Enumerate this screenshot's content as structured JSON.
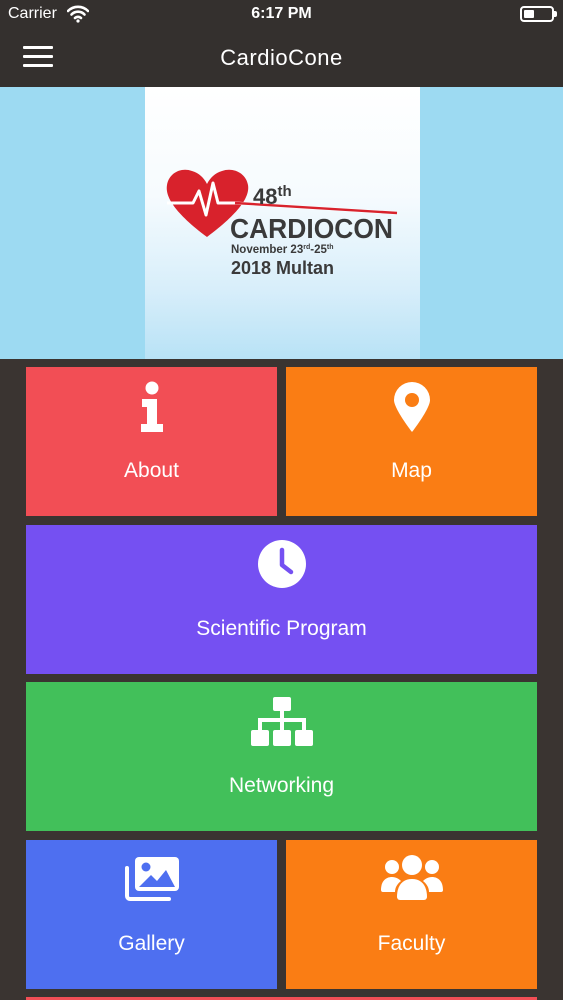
{
  "status_bar": {
    "carrier": "Carrier",
    "time": "6:17 PM"
  },
  "nav": {
    "title": "CardioCone"
  },
  "banner": {
    "edition": "48",
    "edition_suffix": "th",
    "name": "CARDIOCON",
    "dates_prefix": "November 23",
    "dates_sup1": "rd",
    "dates_mid": "-25",
    "dates_sup2": "th",
    "year_city": "2018 Multan",
    "colors": {
      "heart": "#d8222c",
      "text": "#3a3a3a"
    }
  },
  "tiles": {
    "about": {
      "label": "About",
      "icon": "info-icon",
      "color": "#f24e55"
    },
    "map": {
      "label": "Map",
      "icon": "map-marker-icon",
      "color": "#fa7d14"
    },
    "scientific_program": {
      "label": "Scientific Program",
      "icon": "clock-icon",
      "color": "#7550f2"
    },
    "networking": {
      "label": "Networking",
      "icon": "sitemap-icon",
      "color": "#42c05a"
    },
    "gallery": {
      "label": "Gallery",
      "icon": "images-icon",
      "color": "#4e6ff0"
    },
    "faculty": {
      "label": "Faculty",
      "icon": "users-icon",
      "color": "#fa7d14"
    }
  }
}
